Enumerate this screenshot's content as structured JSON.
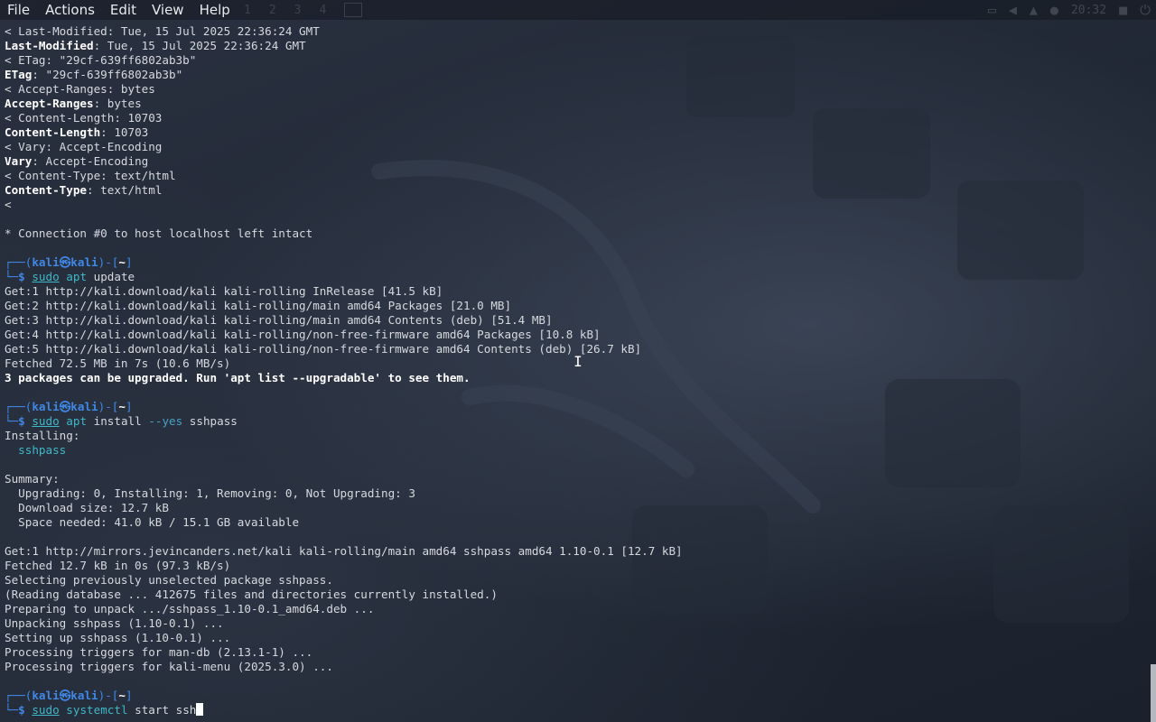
{
  "menu": [
    "File",
    "Actions",
    "Edit",
    "View",
    "Help"
  ],
  "tray": {
    "workspaces": [
      "1",
      "2",
      "3",
      "4"
    ],
    "clock": "20:32"
  },
  "terminal": {
    "lines": [
      {
        "type": "plain",
        "text": "< Last-Modified: Tue, 15 Jul 2025 22:36:24 GMT"
      },
      {
        "type": "header",
        "key": "Last-Modified",
        "value": ": Tue, 15 Jul 2025 22:36:24 GMT"
      },
      {
        "type": "plain",
        "text": "< ETag: \"29cf-639ff6802ab3b\""
      },
      {
        "type": "header",
        "key": "ETag",
        "value": ": \"29cf-639ff6802ab3b\""
      },
      {
        "type": "plain",
        "text": "< Accept-Ranges: bytes"
      },
      {
        "type": "header",
        "key": "Accept-Ranges",
        "value": ": bytes"
      },
      {
        "type": "plain",
        "text": "< Content-Length: 10703"
      },
      {
        "type": "header",
        "key": "Content-Length",
        "value": ": 10703"
      },
      {
        "type": "plain",
        "text": "< Vary: Accept-Encoding"
      },
      {
        "type": "header",
        "key": "Vary",
        "value": ": Accept-Encoding"
      },
      {
        "type": "plain",
        "text": "< Content-Type: text/html"
      },
      {
        "type": "header",
        "key": "Content-Type",
        "value": ": text/html"
      },
      {
        "type": "plain",
        "text": "<"
      },
      {
        "type": "plain",
        "text": ""
      },
      {
        "type": "plain",
        "text": "* Connection #0 to host localhost left intact"
      },
      {
        "type": "plain",
        "text": ""
      },
      {
        "type": "prompt",
        "user": "kali",
        "host": "kali",
        "dir": "~"
      },
      {
        "type": "command",
        "sudo": "sudo",
        "word": "apt",
        "args": [
          {
            "kind": "arg",
            "text": " update"
          }
        ]
      },
      {
        "type": "plain",
        "text": "Get:1 http://kali.download/kali kali-rolling InRelease [41.5 kB]"
      },
      {
        "type": "plain",
        "text": "Get:2 http://kali.download/kali kali-rolling/main amd64 Packages [21.0 MB]"
      },
      {
        "type": "plain",
        "text": "Get:3 http://kali.download/kali kali-rolling/main amd64 Contents (deb) [51.4 MB]"
      },
      {
        "type": "plain",
        "text": "Get:4 http://kali.download/kali kali-rolling/non-free-firmware amd64 Packages [10.8 kB]"
      },
      {
        "type": "plain",
        "text": "Get:5 http://kali.download/kali kali-rolling/non-free-firmware amd64 Contents (deb) [26.7 kB]"
      },
      {
        "type": "plain",
        "text": "Fetched 72.5 MB in 7s (10.6 MB/s)"
      },
      {
        "type": "boldline",
        "text": "3 packages can be upgraded. Run 'apt list --upgradable' to see them."
      },
      {
        "type": "plain",
        "text": ""
      },
      {
        "type": "prompt",
        "user": "kali",
        "host": "kali",
        "dir": "~"
      },
      {
        "type": "command",
        "sudo": "sudo",
        "word": "apt",
        "args": [
          {
            "kind": "arg",
            "text": " install "
          },
          {
            "kind": "flag",
            "text": "--yes"
          },
          {
            "kind": "arg",
            "text": " sshpass"
          }
        ]
      },
      {
        "type": "plain",
        "text": "Installing:"
      },
      {
        "type": "pkg",
        "text": "  sshpass"
      },
      {
        "type": "plain",
        "text": ""
      },
      {
        "type": "plain",
        "text": "Summary:"
      },
      {
        "type": "plain",
        "text": "  Upgrading: 0, Installing: 1, Removing: 0, Not Upgrading: 3"
      },
      {
        "type": "plain",
        "text": "  Download size: 12.7 kB"
      },
      {
        "type": "plain",
        "text": "  Space needed: 41.0 kB / 15.1 GB available"
      },
      {
        "type": "plain",
        "text": ""
      },
      {
        "type": "plain",
        "text": "Get:1 http://mirrors.jevincanders.net/kali kali-rolling/main amd64 sshpass amd64 1.10-0.1 [12.7 kB]"
      },
      {
        "type": "plain",
        "text": "Fetched 12.7 kB in 0s (97.3 kB/s)"
      },
      {
        "type": "plain",
        "text": "Selecting previously unselected package sshpass."
      },
      {
        "type": "plain",
        "text": "(Reading database ... 412675 files and directories currently installed.)"
      },
      {
        "type": "plain",
        "text": "Preparing to unpack .../sshpass_1.10-0.1_amd64.deb ..."
      },
      {
        "type": "plain",
        "text": "Unpacking sshpass (1.10-0.1) ..."
      },
      {
        "type": "plain",
        "text": "Setting up sshpass (1.10-0.1) ..."
      },
      {
        "type": "plain",
        "text": "Processing triggers for man-db (2.13.1-1) ..."
      },
      {
        "type": "plain",
        "text": "Processing triggers for kali-menu (2025.3.0) ..."
      },
      {
        "type": "plain",
        "text": ""
      },
      {
        "type": "prompt",
        "user": "kali",
        "host": "kali",
        "dir": "~"
      },
      {
        "type": "command",
        "sudo": "sudo",
        "word": "systemctl",
        "args": [
          {
            "kind": "arg",
            "text": " start ssh"
          }
        ],
        "cursor": true
      }
    ]
  }
}
